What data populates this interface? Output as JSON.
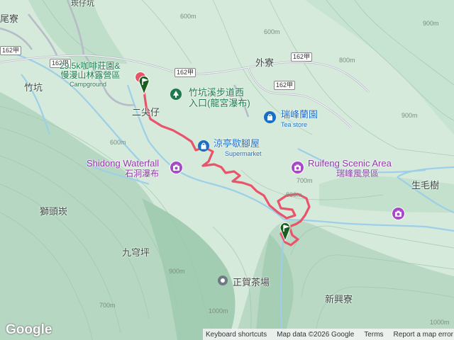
{
  "places": {
    "zhukeng": "竹坑",
    "waiLiao": "外寮",
    "erJiaZai": "二尖仔",
    "shiTouTan": "獅頭崁",
    "jiuQiongPing": "九穹坪",
    "xinXingLiao": "新興寮",
    "shengMaoShu": "生毛樹",
    "xiLiao": "尾寮",
    "topRoad": "崁仔坑"
  },
  "pois": {
    "camp_line1": "29.5k咖啡莊園&",
    "camp_line2": "慢漫山林露營區",
    "camp_en": "Campground",
    "trail_line1": "竹坑溪步道西",
    "trail_line2": "入口(龍宮瀑布)",
    "ruifeng_tea": "瑞峰蘭園",
    "ruifeng_tea_en": "Tea store",
    "liangting": "涼亭歇腳屋",
    "liangting_en": "Supermarket",
    "shidong_en": "Shidong Waterfall",
    "shidong_zh": "石洞瀑布",
    "ruifeng_scenic_en": "Ruifeng Scenic Area",
    "ruifeng_scenic_zh": "瑞峰風景區",
    "zhenghe_tea": "正賀茶場"
  },
  "roads": [
    "162甲",
    "162甲",
    "162甲",
    "162甲",
    "162甲"
  ],
  "contours": [
    "600m",
    "600m",
    "700m",
    "800m",
    "800m",
    "900m",
    "900m",
    "900m",
    "1000m",
    "1000m",
    "700m",
    "600m"
  ],
  "footer": {
    "shortcuts": "Keyboard shortcuts",
    "mapdata": "Map data ©2026 Google",
    "terms": "Terms",
    "report": "Report a map error"
  },
  "brand": "Google",
  "colors": {
    "terrain_light": "#d8ecdf",
    "terrain_mid": "#b9dbc6",
    "terrain_dark": "#8fbfa3",
    "water": "#9fd0ea",
    "road": "#c9cdd6",
    "track": "#e8556a",
    "poi_green": "#1e7a4e",
    "poi_purple": "#8e3aa5",
    "poi_blue": "#1a6fc4"
  },
  "icons": [
    "start-marker-icon",
    "end-marker-icon",
    "camera-icon",
    "shopping-bag-icon",
    "park-icon",
    "pin-icon"
  ]
}
